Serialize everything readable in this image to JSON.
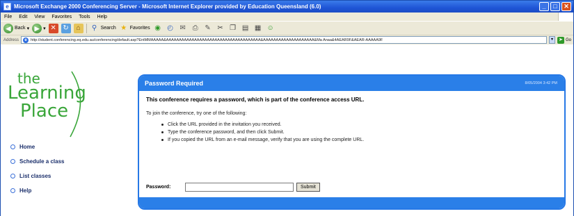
{
  "window": {
    "title": "Microsoft Exchange 2000 Conferencing Server - Microsoft Internet Explorer provided by Education Queensland (6.0)",
    "buttons": [
      "_",
      "□",
      "✕"
    ]
  },
  "menu": [
    "File",
    "Edit",
    "View",
    "Favorites",
    "Tools",
    "Help"
  ],
  "toolbar": {
    "back_label": "Back",
    "search_label": "Search",
    "favorites_label": "Favorites"
  },
  "address": {
    "label": "Address",
    "url": "http://student.conferencing.eq.edu.au/conferencing/default.asp?EntMMAAAAA&AAAAAAAAAAAAAAAAAAAAAAAAAAAAAAAAAAAAA&AAAAAAAAAAAAAAAAAAAA&Ma Anaa&4AEAR9F&AEAR-AAAAA9F",
    "go_label": "Go"
  },
  "logo": {
    "line1": "the",
    "line2": "Learning",
    "line3": "Place"
  },
  "nav": {
    "items": [
      {
        "label": "Home"
      },
      {
        "label": "Schedule a class"
      },
      {
        "label": "List classes"
      },
      {
        "label": "Help"
      }
    ]
  },
  "panel": {
    "title": "Password Required",
    "time": "8/05/2004 3:42 PM",
    "headline": "This conference requires a password, which is part of the conference access URL.",
    "intro": "To join the conference, try one of the following:",
    "steps": [
      "Click the URL provided in the invitation you received.",
      "Type the conference password, and then click Submit.",
      "If you copied the URL from an e-mail message, verify that you are using the complete URL."
    ],
    "password_label": "Password:",
    "password_value": "",
    "submit_label": "Submit"
  },
  "colors": {
    "titlebar": "#1f55d6",
    "panel_blue": "#2a7fe8",
    "logo_green": "#3aa63a",
    "nav_text": "#1b2f6b"
  }
}
